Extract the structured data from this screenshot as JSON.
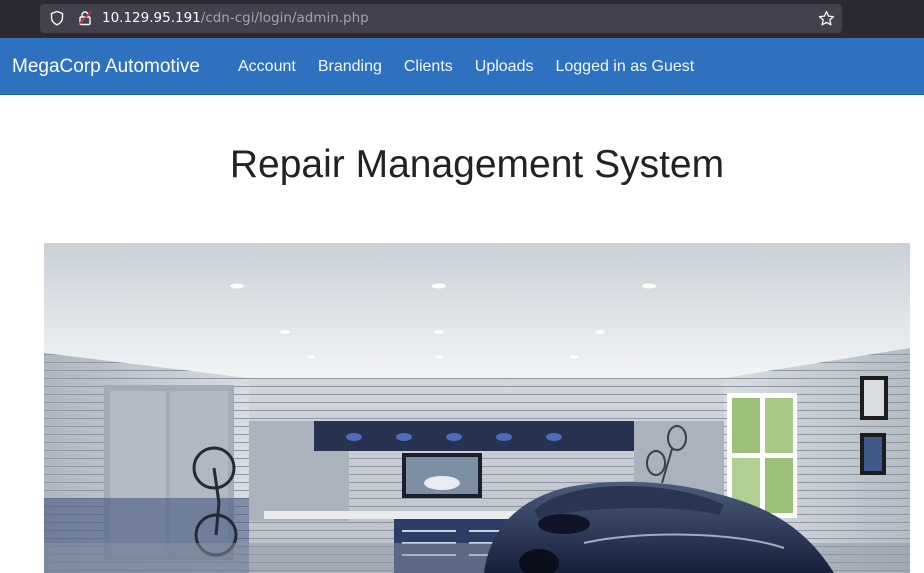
{
  "browser": {
    "url_host": "10.129.95.191",
    "url_path": "/cdn-cgi/login/admin.php",
    "icons": [
      "shield-icon",
      "lock-icon",
      "star-icon"
    ]
  },
  "navbar": {
    "brand": "MegaCorp Automotive",
    "items": [
      {
        "label": "Account"
      },
      {
        "label": "Branding"
      },
      {
        "label": "Clients"
      },
      {
        "label": "Uploads"
      },
      {
        "label": "Logged in as Guest"
      }
    ],
    "color": "#2e71be"
  },
  "main": {
    "title": "Repair Management System",
    "hero_image": "garage-with-sports-car"
  }
}
